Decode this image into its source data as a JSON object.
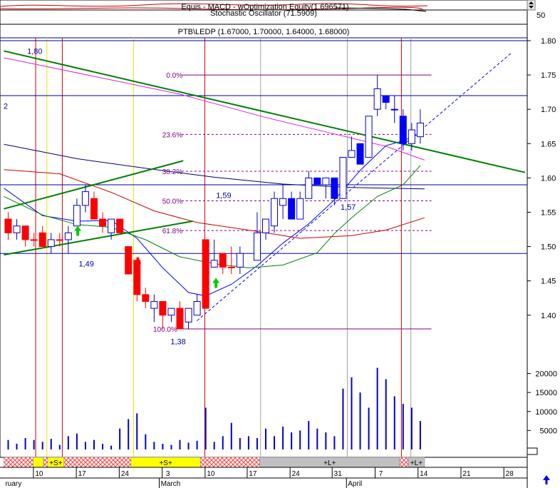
{
  "header": {
    "equity_title": "Equis - MACD - wOptimization Equity(1.696571)",
    "stoch_title": "Stochastic Oscillator (71.5909)",
    "stoch_tick": "50",
    "price_title": "PTB\\LEDP (1.67000, 1.70000, 1.64000, 1.68000)"
  },
  "colors": {
    "up_candle": "#ffffff",
    "down_candle_early": "#ff0000",
    "down_candle_late": "#0000ff",
    "volume": "#0000cc",
    "trend_green": "#008000",
    "ma_magenta": "#e020e0",
    "ma_navy": "#000080",
    "ma_red": "#cc0000",
    "ma_blue": "#0000ff",
    "ma_green": "#008000",
    "band_yellow": "#ffff00",
    "band_gray": "#c0c0c0"
  },
  "chart_data": {
    "type": "candlestick",
    "price_axis": {
      "ticks": [
        "1.80",
        "1.75",
        "1.70",
        "1.65",
        "1.60",
        "1.55",
        "1.50",
        "1.45",
        "1.40"
      ],
      "range": [
        1.368,
        1.845
      ]
    },
    "volume_axis": {
      "ticks": [
        "20000",
        "15000",
        "10000",
        "5000"
      ],
      "range": [
        0,
        25200
      ]
    },
    "date_axis": {
      "day_labels": [
        "10",
        "17",
        "24",
        "3",
        "10",
        "17",
        "24",
        "31",
        "7",
        "14",
        "21",
        "28"
      ],
      "month_labels": [
        "ruary",
        "March",
        "April"
      ]
    },
    "candles": [
      {
        "x": 0,
        "o": 1.54,
        "h": 1.55,
        "l": 1.51,
        "c": 1.52,
        "kind": "down"
      },
      {
        "x": 1,
        "o": 1.52,
        "h": 1.54,
        "l": 1.51,
        "c": 1.53,
        "kind": "up"
      },
      {
        "x": 2,
        "o": 1.53,
        "h": 1.53,
        "l": 1.5,
        "c": 1.51,
        "kind": "down"
      },
      {
        "x": 3,
        "o": 1.51,
        "h": 1.52,
        "l": 1.5,
        "c": 1.51,
        "kind": "down"
      },
      {
        "x": 4,
        "o": 1.52,
        "h": 1.53,
        "l": 1.5,
        "c": 1.5,
        "kind": "down"
      },
      {
        "x": 5,
        "o": 1.5,
        "h": 1.52,
        "l": 1.49,
        "c": 1.51,
        "kind": "up"
      },
      {
        "x": 6,
        "o": 1.51,
        "h": 1.52,
        "l": 1.5,
        "c": 1.51,
        "kind": "down"
      },
      {
        "x": 7,
        "o": 1.51,
        "h": 1.53,
        "l": 1.49,
        "c": 1.52,
        "kind": "up"
      },
      {
        "x": 8,
        "o": 1.53,
        "h": 1.57,
        "l": 1.53,
        "c": 1.56,
        "kind": "up"
      },
      {
        "x": 9,
        "o": 1.56,
        "h": 1.59,
        "l": 1.55,
        "c": 1.58,
        "kind": "up"
      },
      {
        "x": 10,
        "o": 1.57,
        "h": 1.58,
        "l": 1.54,
        "c": 1.54,
        "kind": "down"
      },
      {
        "x": 11,
        "o": 1.54,
        "h": 1.55,
        "l": 1.52,
        "c": 1.53,
        "kind": "down"
      },
      {
        "x": 12,
        "o": 1.52,
        "h": 1.54,
        "l": 1.51,
        "c": 1.54,
        "kind": "up"
      },
      {
        "x": 13,
        "o": 1.54,
        "h": 1.54,
        "l": 1.52,
        "c": 1.52,
        "kind": "down"
      },
      {
        "x": 14,
        "o": 1.5,
        "h": 1.5,
        "l": 1.46,
        "c": 1.46,
        "kind": "down"
      },
      {
        "x": 15,
        "o": 1.48,
        "h": 1.48,
        "l": 1.42,
        "c": 1.43,
        "kind": "down"
      },
      {
        "x": 16,
        "o": 1.43,
        "h": 1.44,
        "l": 1.41,
        "c": 1.42,
        "kind": "down"
      },
      {
        "x": 17,
        "o": 1.42,
        "h": 1.43,
        "l": 1.39,
        "c": 1.41,
        "kind": "up"
      },
      {
        "x": 18,
        "o": 1.42,
        "h": 1.42,
        "l": 1.38,
        "c": 1.4,
        "kind": "down"
      },
      {
        "x": 19,
        "o": 1.4,
        "h": 1.41,
        "l": 1.39,
        "c": 1.41,
        "kind": "up"
      },
      {
        "x": 20,
        "o": 1.41,
        "h": 1.42,
        "l": 1.38,
        "c": 1.38,
        "kind": "down"
      },
      {
        "x": 21,
        "o": 1.39,
        "h": 1.41,
        "l": 1.38,
        "c": 1.41,
        "kind": "up"
      },
      {
        "x": 22,
        "o": 1.4,
        "h": 1.43,
        "l": 1.4,
        "c": 1.42,
        "kind": "up"
      },
      {
        "x": 23,
        "o": 1.41,
        "h": 1.51,
        "l": 1.41,
        "c": 1.51,
        "kind": "down"
      },
      {
        "x": 24,
        "o": 1.47,
        "h": 1.51,
        "l": 1.47,
        "c": 1.48,
        "kind": "up"
      },
      {
        "x": 25,
        "o": 1.49,
        "h": 1.49,
        "l": 1.46,
        "c": 1.47,
        "kind": "down"
      },
      {
        "x": 26,
        "o": 1.47,
        "h": 1.5,
        "l": 1.46,
        "c": 1.47,
        "kind": "down"
      },
      {
        "x": 27,
        "o": 1.47,
        "h": 1.5,
        "l": 1.46,
        "c": 1.49,
        "kind": "up"
      },
      {
        "x": 29,
        "o": 1.48,
        "h": 1.55,
        "l": 1.48,
        "c": 1.52,
        "kind": "up"
      },
      {
        "x": 30,
        "o": 1.52,
        "h": 1.54,
        "l": 1.51,
        "c": 1.54,
        "kind": "up"
      },
      {
        "x": 31,
        "o": 1.53,
        "h": 1.58,
        "l": 1.52,
        "c": 1.57,
        "kind": "up"
      },
      {
        "x": 32,
        "o": 1.56,
        "h": 1.59,
        "l": 1.54,
        "c": 1.57,
        "kind": "up"
      },
      {
        "x": 33,
        "o": 1.57,
        "h": 1.58,
        "l": 1.54,
        "c": 1.54,
        "kind": "down_b"
      },
      {
        "x": 34,
        "o": 1.54,
        "h": 1.58,
        "l": 1.54,
        "c": 1.57,
        "kind": "up"
      },
      {
        "x": 35,
        "o": 1.57,
        "h": 1.61,
        "l": 1.57,
        "c": 1.6,
        "kind": "up"
      },
      {
        "x": 36,
        "o": 1.6,
        "h": 1.6,
        "l": 1.59,
        "c": 1.59,
        "kind": "down_b"
      },
      {
        "x": 37,
        "o": 1.59,
        "h": 1.6,
        "l": 1.57,
        "c": 1.6,
        "kind": "up"
      },
      {
        "x": 38,
        "o": 1.6,
        "h": 1.6,
        "l": 1.56,
        "c": 1.57,
        "kind": "down_b"
      },
      {
        "x": 39,
        "o": 1.57,
        "h": 1.63,
        "l": 1.57,
        "c": 1.63,
        "kind": "up"
      },
      {
        "x": 40,
        "o": 1.63,
        "h": 1.66,
        "l": 1.63,
        "c": 1.64,
        "kind": "up"
      },
      {
        "x": 41,
        "o": 1.65,
        "h": 1.65,
        "l": 1.62,
        "c": 1.62,
        "kind": "down_b"
      },
      {
        "x": 42,
        "o": 1.63,
        "h": 1.69,
        "l": 1.63,
        "c": 1.69,
        "kind": "up"
      },
      {
        "x": 43,
        "o": 1.7,
        "h": 1.75,
        "l": 1.69,
        "c": 1.73,
        "kind": "up"
      },
      {
        "x": 44,
        "o": 1.72,
        "h": 1.72,
        "l": 1.7,
        "c": 1.71,
        "kind": "down_b"
      },
      {
        "x": 45,
        "o": 1.7,
        "h": 1.72,
        "l": 1.68,
        "c": 1.7,
        "kind": "up"
      },
      {
        "x": 46,
        "o": 1.69,
        "h": 1.7,
        "l": 1.64,
        "c": 1.65,
        "kind": "down_b"
      },
      {
        "x": 47,
        "o": 1.65,
        "h": 1.68,
        "l": 1.64,
        "c": 1.67,
        "kind": "up"
      },
      {
        "x": 48,
        "o": 1.66,
        "h": 1.7,
        "l": 1.65,
        "c": 1.68,
        "kind": "up"
      }
    ],
    "volumes": [
      {
        "x": 0,
        "v": 2500
      },
      {
        "x": 1,
        "v": 1500
      },
      {
        "x": 2,
        "v": 3000
      },
      {
        "x": 3,
        "v": 2500
      },
      {
        "x": 4,
        "v": 2000
      },
      {
        "x": 5,
        "v": 2800
      },
      {
        "x": 6,
        "v": 1200
      },
      {
        "x": 7,
        "v": 3500
      },
      {
        "x": 8,
        "v": 4200
      },
      {
        "x": 9,
        "v": 2000
      },
      {
        "x": 10,
        "v": 2500
      },
      {
        "x": 11,
        "v": 1500
      },
      {
        "x": 12,
        "v": 1000
      },
      {
        "x": 13,
        "v": 5500
      },
      {
        "x": 14,
        "v": 8000
      },
      {
        "x": 15,
        "v": 9500
      },
      {
        "x": 16,
        "v": 4000
      },
      {
        "x": 17,
        "v": 2000
      },
      {
        "x": 18,
        "v": 1500
      },
      {
        "x": 19,
        "v": 1200
      },
      {
        "x": 20,
        "v": 2500
      },
      {
        "x": 21,
        "v": 1800
      },
      {
        "x": 22,
        "v": 2300
      },
      {
        "x": 23,
        "v": 11000
      },
      {
        "x": 24,
        "v": 2000
      },
      {
        "x": 25,
        "v": 3500
      },
      {
        "x": 26,
        "v": 7000
      },
      {
        "x": 27,
        "v": 3000
      },
      {
        "x": 28,
        "v": 3500
      },
      {
        "x": 29,
        "v": 3000
      },
      {
        "x": 30,
        "v": 5500
      },
      {
        "x": 31,
        "v": 3500
      },
      {
        "x": 32,
        "v": 6000
      },
      {
        "x": 33,
        "v": 4500
      },
      {
        "x": 34,
        "v": 5000
      },
      {
        "x": 35,
        "v": 7500
      },
      {
        "x": 36,
        "v": 5500
      },
      {
        "x": 37,
        "v": 4500
      },
      {
        "x": 38,
        "v": 3500
      },
      {
        "x": 39,
        "v": 16000
      },
      {
        "x": 40,
        "v": 19000
      },
      {
        "x": 41,
        "v": 15000
      },
      {
        "x": 42,
        "v": 11000
      },
      {
        "x": 43,
        "v": 21500
      },
      {
        "x": 44,
        "v": 18500
      },
      {
        "x": 45,
        "v": 14000
      },
      {
        "x": 46,
        "v": 12000
      },
      {
        "x": 47,
        "v": 11000
      },
      {
        "x": 48,
        "v": 7500
      }
    ],
    "fibonacci": [
      {
        "label": "0.0%",
        "value": 1.75
      },
      {
        "label": "23.6%",
        "value": 1.6634
      },
      {
        "label": "38.2%",
        "value": 1.6098
      },
      {
        "label": "50.0%",
        "value": 1.5666
      },
      {
        "label": "61.8%",
        "value": 1.5234
      },
      {
        "label": "100.0%",
        "value": 1.38
      }
    ],
    "horizontal_lines": [
      1.8,
      1.72,
      1.59,
      1.49
    ],
    "price_annotations": [
      {
        "text": "1,80",
        "x": 3.1,
        "y": 1.785
      },
      {
        "text": "2",
        "x": -0.3,
        "y": 1.705
      },
      {
        "text": "1,59",
        "x": 25.1,
        "y": 1.575
      },
      {
        "text": "1,57",
        "x": 39.6,
        "y": 1.558
      },
      {
        "text": "1,49",
        "x": 9.1,
        "y": 1.475
      },
      {
        "text": "1,38",
        "x": 19.8,
        "y": 1.362
      }
    ],
    "trendlines": [
      {
        "name": "",
        "color": "trend_green",
        "points": [
          [
            -0.5,
            1.785
          ],
          [
            60.2,
            1.608
          ]
        ],
        "dash": false,
        "width": 2
      },
      {
        "name": "",
        "color": "trend_green",
        "points": [
          [
            -0.5,
            1.555
          ],
          [
            20.4,
            1.625
          ]
        ],
        "dash": false,
        "width": 2
      },
      {
        "name": "",
        "color": "trend_green",
        "points": [
          [
            -0.5,
            1.488
          ],
          [
            21.5,
            1.537
          ]
        ],
        "dash": false,
        "width": 2
      },
      {
        "name": "",
        "color": "ma_blue",
        "points": [
          [
            22,
            1.392
          ],
          [
            58.6,
            1.782
          ]
        ],
        "dash": true,
        "width": 1
      }
    ],
    "moving_averages": [
      {
        "color": "ma_magenta",
        "points": [
          [
            -0.5,
            1.775
          ],
          [
            10,
            1.748
          ],
          [
            20,
            1.722
          ],
          [
            30,
            1.688
          ],
          [
            38,
            1.664
          ],
          [
            44,
            1.646
          ],
          [
            48.5,
            1.626
          ]
        ]
      },
      {
        "color": "ma_navy",
        "points": [
          [
            -0.5,
            1.649
          ],
          [
            8,
            1.628
          ],
          [
            16,
            1.614
          ],
          [
            24,
            1.601
          ],
          [
            32,
            1.591
          ],
          [
            40,
            1.586
          ],
          [
            48.5,
            1.584
          ]
        ]
      },
      {
        "color": "ma_red",
        "points": [
          [
            -0.5,
            1.612
          ],
          [
            6,
            1.606
          ],
          [
            12,
            1.579
          ],
          [
            17,
            1.552
          ],
          [
            22,
            1.535
          ],
          [
            28,
            1.524
          ],
          [
            34,
            1.512
          ],
          [
            40,
            1.516
          ],
          [
            44,
            1.524
          ],
          [
            48.5,
            1.542
          ]
        ]
      },
      {
        "color": "ma_blue",
        "points": [
          [
            -0.5,
            1.585
          ],
          [
            4,
            1.545
          ],
          [
            8,
            1.537
          ],
          [
            12,
            1.538
          ],
          [
            15,
            1.512
          ],
          [
            18,
            1.469
          ],
          [
            21,
            1.433
          ],
          [
            23,
            1.428
          ],
          [
            26,
            1.445
          ],
          [
            29,
            1.472
          ],
          [
            32,
            1.505
          ],
          [
            35,
            1.533
          ],
          [
            38,
            1.568
          ],
          [
            41,
            1.611
          ],
          [
            44,
            1.647
          ],
          [
            46,
            1.654
          ],
          [
            48,
            1.665
          ]
        ]
      },
      {
        "color": "ma_green",
        "points": [
          [
            -0.5,
            1.573
          ],
          [
            4,
            1.546
          ],
          [
            8,
            1.532
          ],
          [
            12,
            1.528
          ],
          [
            16,
            1.51
          ],
          [
            20,
            1.485
          ],
          [
            24,
            1.475
          ],
          [
            28,
            1.469
          ],
          [
            32,
            1.473
          ],
          [
            36,
            1.491
          ],
          [
            38,
            1.519
          ],
          [
            40,
            1.542
          ],
          [
            43,
            1.573
          ],
          [
            46,
            1.59
          ],
          [
            48,
            1.618
          ]
        ]
      }
    ],
    "vertical_lines": [
      {
        "x": 3.2,
        "color": "red"
      },
      {
        "x": 4.5,
        "color": "yellow"
      },
      {
        "x": 6.3,
        "color": "red"
      },
      {
        "x": 14.6,
        "color": "yellow"
      },
      {
        "x": 22.9,
        "color": "red"
      },
      {
        "x": 29.4,
        "color": "gray"
      },
      {
        "x": 39.5,
        "color": "gray"
      },
      {
        "x": 45.8,
        "color": "red"
      },
      {
        "x": 46.9,
        "color": "gray"
      }
    ],
    "signals": [
      {
        "type": "buy",
        "x": 8.1,
        "y": 1.523
      },
      {
        "type": "sell",
        "x": 15.1,
        "y": 1.477
      },
      {
        "type": "buy",
        "x": 24.2,
        "y": 1.447
      }
    ],
    "signal_bar": [
      {
        "from": -0.5,
        "to": 2.9,
        "fill": "hatch",
        "label": ""
      },
      {
        "from": 2.9,
        "to": 4.1,
        "fill": "yellow",
        "label": ""
      },
      {
        "from": 4.1,
        "to": 4.6,
        "fill": "hatch",
        "label": ""
      },
      {
        "from": 4.6,
        "to": 6.5,
        "fill": "yellow",
        "label": "+S+"
      },
      {
        "from": 6.5,
        "to": 14.3,
        "fill": "hatch",
        "label": ""
      },
      {
        "from": 14.3,
        "to": 22.4,
        "fill": "yellow",
        "label": "+S+"
      },
      {
        "from": 22.4,
        "to": 29.3,
        "fill": "hatch",
        "label": ""
      },
      {
        "from": 29.3,
        "to": 45.6,
        "fill": "gray",
        "label": "+L+"
      },
      {
        "from": 45.6,
        "to": 46.6,
        "fill": "hatch",
        "label": ""
      },
      {
        "from": 46.6,
        "to": 48.5,
        "fill": "gray",
        "label": "+L+"
      }
    ]
  }
}
